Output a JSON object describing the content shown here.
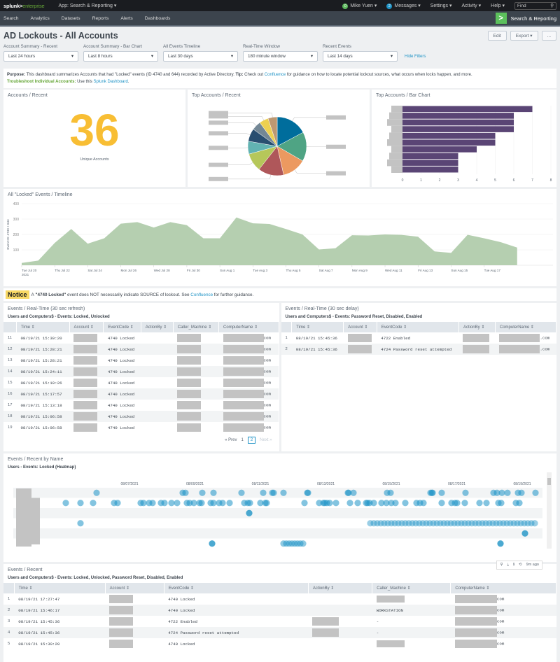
{
  "topbar": {
    "logo_main": "splunk>",
    "logo_suffix": "enterprise",
    "app_menu": "App: Search & Reporting ▾",
    "user": "Mike Yuen ▾",
    "user_badge": "0",
    "messages": "Messages ▾",
    "messages_badge": "2",
    "settings": "Settings ▾",
    "activity": "Activity ▾",
    "help": "Help ▾",
    "find_placeholder": "Find",
    "search_icon": "⚲"
  },
  "nav": {
    "items": [
      "Search",
      "Analytics",
      "Datasets",
      "Reports",
      "Alerts",
      "Dashboards"
    ],
    "app_icon": ">",
    "app_name": "Search & Reporting"
  },
  "header": {
    "title": "AD Lockouts - All Accounts",
    "edit": "Edit",
    "export": "Export ▾",
    "more": "...",
    "hide_filters": "Hide Filters",
    "filters": [
      {
        "label": "Account Summary - Recent",
        "value": "Last 24 hours"
      },
      {
        "label": "Account Summary - Bar Chart",
        "value": "Last 8 hours"
      },
      {
        "label": "All Events Timeline",
        "value": "Last 30 days"
      },
      {
        "label": "Real-Time Window",
        "value": "180 minute window"
      },
      {
        "label": "Recent Events",
        "value": "Last 14 days"
      }
    ]
  },
  "purpose": {
    "label": "Purpose:",
    "text": " This dashboard summarizes Accounts that had \"Locked\" events (ID 4740 and 644) recorded by Active Directory. ",
    "tip_label": "Tip:",
    "tip_text": " Check out ",
    "tip_link": "Confluence",
    "tip_rest": " for guidance on how to locate potential lockout sources, what occurs when locks happen, and more.",
    "troubleshoot_label": "Troubleshoot Individual Accounts:",
    "troubleshoot_text": " Use this ",
    "troubleshoot_link": "Splunk Dashboard",
    "troubleshoot_end": "."
  },
  "panels": {
    "accounts_recent": {
      "title": "Accounts / Recent",
      "value": "36",
      "label": "Unique Accounts",
      "color": "#f8be34"
    },
    "top_accounts_pie": {
      "title": "Top Accounts / Recent"
    },
    "top_accounts_bar": {
      "title": "Top Accounts / Bar Chart"
    },
    "timeline": {
      "title": "All \"Locked\" Events / Timeline"
    }
  },
  "chart_data": [
    {
      "type": "pie",
      "title": "Top Accounts / Recent",
      "labels_redacted": true,
      "values": [
        17,
        16,
        13,
        14,
        10,
        7,
        7,
        5,
        5,
        5
      ],
      "colors": [
        "#006d9c",
        "#4fa484",
        "#ec9960",
        "#af575a",
        "#b6c75a",
        "#62b3b2",
        "#294e70",
        "#738795",
        "#edd051",
        "#bd9872"
      ]
    },
    {
      "type": "bar",
      "orientation": "horizontal",
      "title": "Top Accounts / Bar Chart",
      "categories_redacted": true,
      "values": [
        7,
        6,
        6,
        6,
        5,
        5,
        4,
        3,
        3,
        3
      ],
      "xlim": [
        0,
        8
      ],
      "xticks": [
        "0",
        "1",
        "2",
        "3",
        "4",
        "5",
        "6",
        "7",
        "8"
      ],
      "color": "#5a4575"
    },
    {
      "type": "area",
      "title": "All \"Locked\" Events / Timeline",
      "ylabel": "Event ID: 4740 + 644",
      "ylim": [
        0,
        400
      ],
      "yticks": [
        "100",
        "200",
        "300",
        "400"
      ],
      "xticks": [
        "Tue Jul 20\n2021",
        "Thu Jul 22",
        "Sat Jul 24",
        "Mon Jul 26",
        "Wed Jul 28",
        "Fri Jul 30",
        "Sun Aug 1",
        "Tue Aug 3",
        "Thu Aug 5",
        "Sat Aug 7",
        "Mon Aug 9",
        "Wed Aug 11",
        "Fri Aug 13",
        "Sun Aug 15",
        "Tue Aug 17"
      ],
      "values": [
        15,
        30,
        145,
        235,
        140,
        175,
        270,
        280,
        245,
        280,
        260,
        175,
        175,
        310,
        272,
        268,
        235,
        200,
        102,
        110,
        195,
        193,
        200,
        197,
        185,
        90,
        80,
        198,
        175,
        150,
        115
      ],
      "color": "#b5cfb0"
    }
  ],
  "notice": {
    "tag": "Notice",
    "pre": "A ",
    "bold": "\"4740 Locked\"",
    "mid": " event does NOT necessarily indicate SOURCE of lockout. See ",
    "link": "Confluence",
    "post": " for further guidance."
  },
  "realtime_left": {
    "title": "Events / Real-Time (30 sec refresh)",
    "subtitle": "Users and Computers$ - Events: Locked, Unlocked",
    "columns": [
      "Time ⇕",
      "Account ⇕",
      "EventCode ⇕",
      "ActionBy ⇕",
      "Caller_Machine ⇕",
      "ComputerName ⇕"
    ],
    "rows": [
      {
        "n": "11",
        "time": "08/19/21 15:30:20",
        "code": "4740 Locked",
        "cn": "com"
      },
      {
        "n": "12",
        "time": "08/19/21 15:28:21",
        "code": "4740 Locked",
        "cn": "com"
      },
      {
        "n": "13",
        "time": "08/19/21 15:28:21",
        "code": "4740 Locked",
        "cn": "com"
      },
      {
        "n": "14",
        "time": "08/19/21 15:24:11",
        "code": "4740 Locked",
        "cn": "com"
      },
      {
        "n": "15",
        "time": "08/19/21 15:19:26",
        "code": "4740 Locked",
        "cn": "com"
      },
      {
        "n": "16",
        "time": "08/19/21 15:17:57",
        "code": "4740 Locked",
        "cn": "com"
      },
      {
        "n": "17",
        "time": "08/19/21 15:13:18",
        "code": "4740 Locked",
        "cn": "com"
      },
      {
        "n": "18",
        "time": "08/19/21 15:06:58",
        "code": "4740 Locked",
        "cn": "com"
      },
      {
        "n": "19",
        "time": "08/19/21 15:06:58",
        "code": "4740 Locked",
        "cn": "com"
      }
    ],
    "pager": {
      "prev": "« Prev",
      "pages": [
        "1",
        "2"
      ],
      "current": "2",
      "next": "Next »"
    }
  },
  "realtime_right": {
    "title": "Events / Real-Time (30 sec delay)",
    "subtitle": "Users and Computers$ - Events: Password Reset, Disabled, Enabled",
    "columns": [
      "Time ⇕",
      "Account ⇕",
      "EventCode ⇕",
      "ActionBy ⇕",
      "ComputerName ⇕"
    ],
    "rows": [
      {
        "n": "1",
        "time": "08/19/21 15:45:36",
        "code": "4722 Enabled",
        "cn": ".com"
      },
      {
        "n": "2",
        "time": "08/19/21 15:45:36",
        "code": "4724 Password reset attempted",
        "cn": ".com"
      }
    ]
  },
  "heatmap": {
    "title": "Events / Recent by Name",
    "subtitle": "Users - Events: Locked (Heatmap)",
    "dates": [
      "08/07/2021",
      "08/09/2021",
      "08/11/2021",
      "08/13/2021",
      "08/15/2021",
      "08/17/2021",
      "08/19/2021"
    ],
    "toolbar_time": "9m ago",
    "dot_color": "#1e93c6"
  },
  "recent": {
    "title": "Events / Recent",
    "subtitle": "Users and Computers$ - Events: Locked, Unlocked, Password Reset, Disabled, Enabled",
    "columns": [
      "Time ⇕",
      "Account ⇕",
      "EventCode ⇕",
      "ActionBy ⇕",
      "Caller_Machine ⇕",
      "ComputerName ⇕"
    ],
    "rows": [
      {
        "n": "1",
        "time": "08/19/21 17:27:47",
        "code": "4740 Locked",
        "caller": "",
        "cn": "com"
      },
      {
        "n": "2",
        "time": "08/19/21 15:46:17",
        "code": "4740 Locked",
        "caller": "WORKSTATION",
        "cn": "com"
      },
      {
        "n": "3",
        "time": "08/19/21 15:45:36",
        "code": "4722 Enabled",
        "caller": "-",
        "cn": "com"
      },
      {
        "n": "4",
        "time": "08/19/21 15:45:36",
        "code": "4724 Password reset attempted",
        "caller": "-",
        "cn": "com"
      },
      {
        "n": "5",
        "time": "08/19/21 15:30:20",
        "code": "4740 Locked",
        "caller": "",
        "cn": "com"
      }
    ]
  }
}
